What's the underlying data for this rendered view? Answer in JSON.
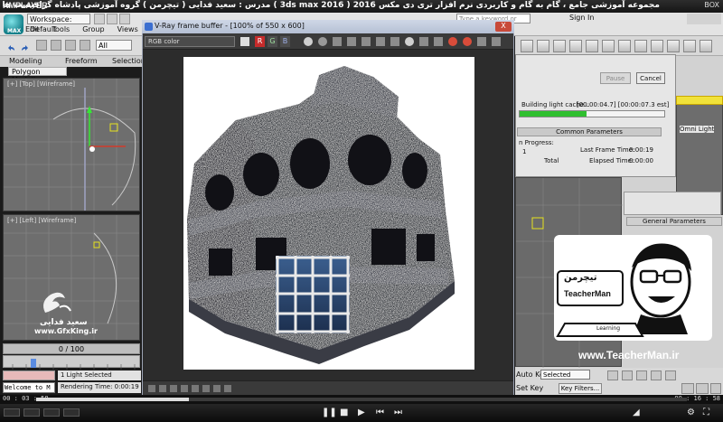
{
  "player": {
    "logo": "KMPLAYER",
    "title": "مجموعه آموزشی جامع ، گام به گام و کاربردی نرم افزار تری دی مکس 2016 ( 3ds max 2016 )  مدرس : سعید فدایی ( تیچرمن ) گروه آموزشی پادشاه گرافیست ها",
    "window_label": "BOX",
    "time_elapsed": "00 : 03 : 58",
    "time_total": "00 : 16 : 58",
    "progress_fraction": 0.235
  },
  "max": {
    "logo_text": "MAX",
    "workspace": "Workspace: Default",
    "menus": [
      "Edit",
      "Tools",
      "Group",
      "Views"
    ],
    "search_placeholder": "Type a keyword or phrase",
    "sign_in": "Sign In",
    "selection_filter": "All",
    "ribbon_tabs": [
      "Modeling",
      "Freeform",
      "Selection"
    ],
    "ribbon_panel": "Polygon Modeling",
    "viewport_top_label": "[+] [Top] [Wireframe]",
    "viewport_left_label": "[+] [Left] [Wireframe]",
    "time_slider": "0 / 100",
    "maxscript_text": "Welcome to M",
    "status_selection": "1 Light Selected",
    "status_rendering": "Rendering Time: 0:00:19",
    "auto_key": "Auto Key",
    "set_key": "Set Key",
    "selected_dropdown": "Selected",
    "key_filters": "Key Filters..."
  },
  "vfb": {
    "title": "V-Ray frame buffer - [100% of 550 x 600]",
    "channel": "RGB color",
    "close_label": "X",
    "rgb_buttons": [
      "R",
      "G",
      "B"
    ]
  },
  "render_dialog": {
    "pause": "Pause",
    "cancel": "Cancel",
    "progress_label": "Building light cache...",
    "progress_time": "[00:00:04.7] [00:00:07.3 est]",
    "progress_fraction": 0.46,
    "common_params": "Common Parameters",
    "progress_header": "n Progress:",
    "col_1": "1",
    "col_total": "Total",
    "last_frame_time_label": "Last Frame Time:",
    "last_frame_time": "0:00:19",
    "elapsed_time_label": "Elapsed Time:",
    "elapsed_time": "0:00:00",
    "light_label": "Omni Light",
    "general_params": "General Parameters"
  },
  "watermark": {
    "name": "سعید فدایی",
    "url": "www.GfxKing.ir"
  },
  "teacher": {
    "brand_fa": "تیچرمن",
    "brand_en": "TeacherMan",
    "tagline": "Learning",
    "url": "www.TeacherMan.ir"
  },
  "colors": {
    "progress_green": "#2fbf2f",
    "vfb_bg": "#2a2a2a",
    "max_gray": "#e3e3e3"
  }
}
